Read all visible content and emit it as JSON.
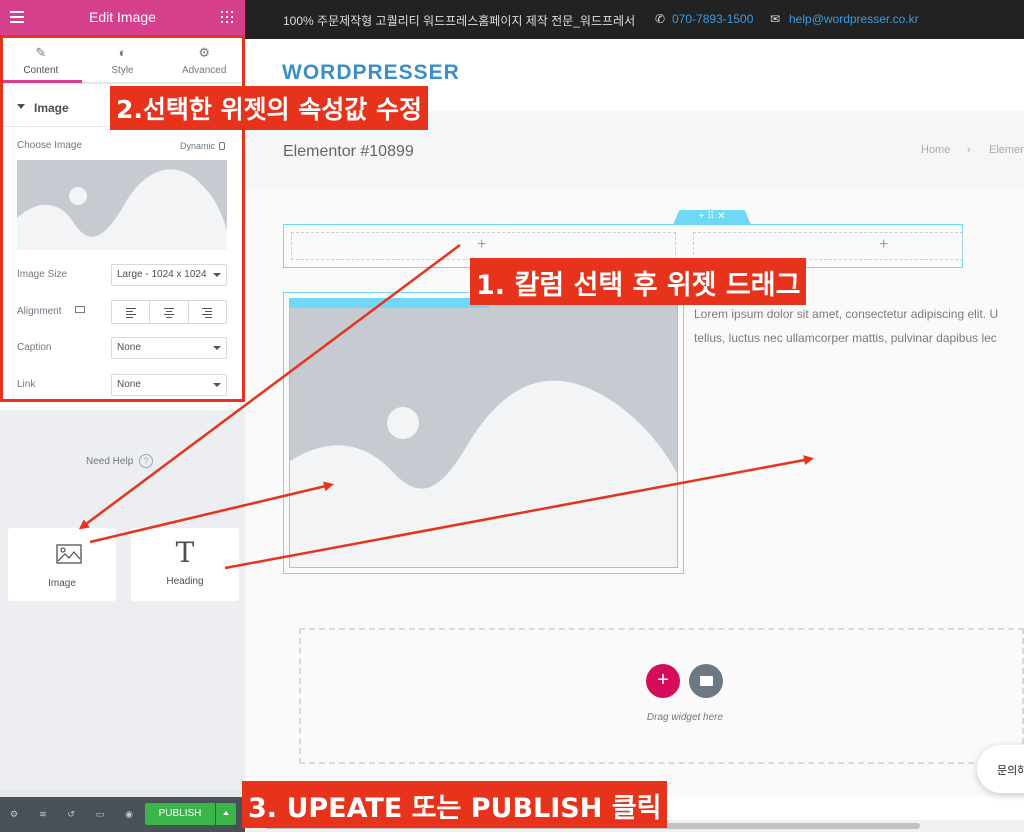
{
  "panel": {
    "title": "Edit Image",
    "tabs": [
      {
        "label": "Content",
        "icon": "pencil-icon"
      },
      {
        "label": "Style",
        "icon": "half-circle-icon"
      },
      {
        "label": "Advanced",
        "icon": "gear-icon"
      }
    ],
    "section_title": "Image",
    "choose_image_label": "Choose Image",
    "dynamic_label": "Dynamic",
    "image_size_label": "Image Size",
    "image_size_value": "Large - 1024 x 1024",
    "alignment_label": "Alignment",
    "caption_label": "Caption",
    "caption_value": "None",
    "link_label": "Link",
    "link_value": "None",
    "need_help": "Need Help",
    "widgets": [
      {
        "label": "Image",
        "icon": "image-icon"
      },
      {
        "label": "Heading",
        "icon": "heading-icon"
      }
    ],
    "publish_label": "PUBLISH",
    "accent": "#d63f8c",
    "publish_color": "#39b54a"
  },
  "topbar": {
    "tagline": "100% 주문제작형 고퀄리티 워드프레스홈페이지 제작 전문_워드프레서",
    "phone": "070-7893-1500",
    "email": "help@wordpresser.co.kr"
  },
  "site": {
    "logo": "WORDPRESSER",
    "page_title": "Elementor #10899",
    "breadcrumb_home": "Home",
    "breadcrumb_current": "Elemen"
  },
  "canvas": {
    "lorem_line1": "Lorem ipsum dolor sit amet, consectetur adipiscing elit. U",
    "lorem_line2": "tellus, luctus nec ullamcorper mattis, pulvinar dapibus lec",
    "drag_widget": "Drag widget here",
    "chat": "문의하"
  },
  "annotations": {
    "step1": "1. 칼럼 선택 후 위젯 드래그",
    "step2": "2.선택한 위젯의 속성값 수정",
    "step3": "3. UPEATE 또는 PUBLISH 클릭",
    "color": "#e8331c"
  }
}
